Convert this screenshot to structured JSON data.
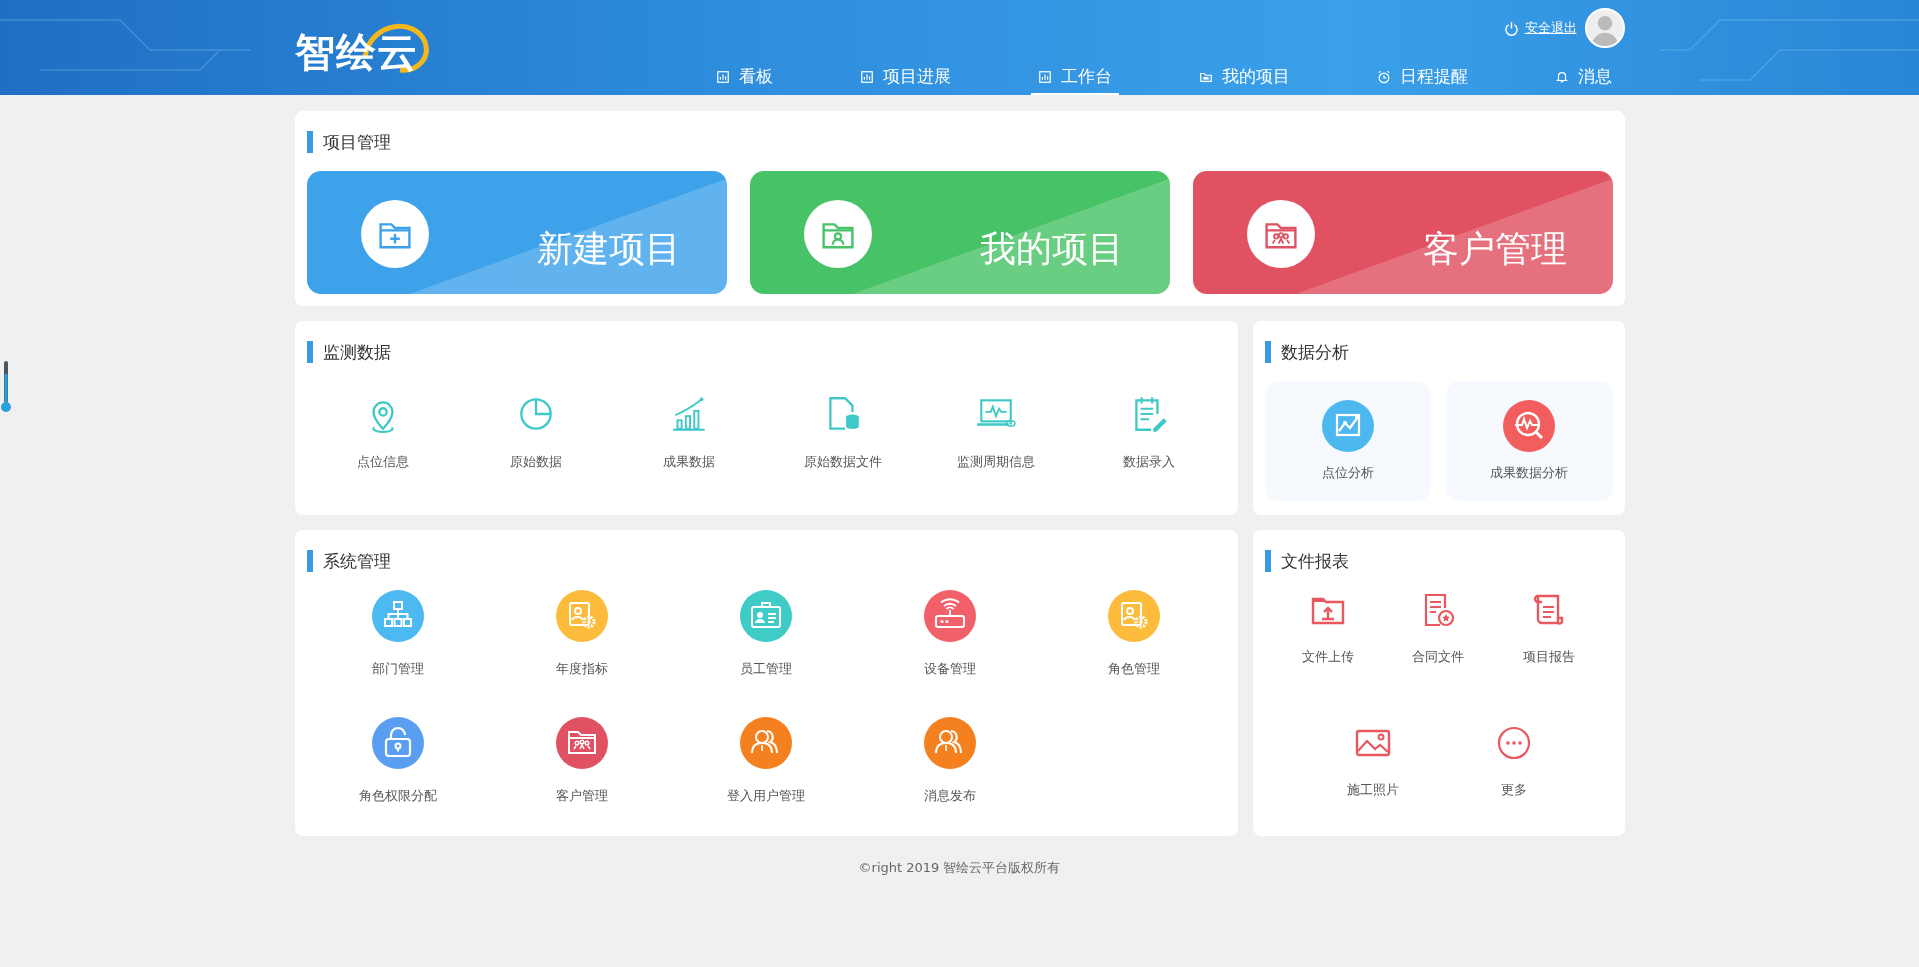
{
  "header": {
    "logo": "智绘云",
    "logout": "安全退出",
    "nav": [
      {
        "label": "看板",
        "selected": false
      },
      {
        "label": "项目进展",
        "selected": false
      },
      {
        "label": "工作台",
        "selected": true
      },
      {
        "label": "我的项目",
        "selected": false
      },
      {
        "label": "日程提醒",
        "selected": false
      },
      {
        "label": "消息",
        "selected": false
      }
    ]
  },
  "project_management": {
    "title": "项目管理",
    "tiles": [
      {
        "label": "新建项目",
        "color": "#3da2ea"
      },
      {
        "label": "我的项目",
        "color": "#48c267"
      },
      {
        "label": "客户管理",
        "color": "#e05262"
      }
    ]
  },
  "monitoring": {
    "title": "监测数据",
    "items": [
      "点位信息",
      "原始数据",
      "成果数据",
      "原始数据文件",
      "监测周期信息",
      "数据录入"
    ]
  },
  "analysis": {
    "title": "数据分析",
    "items": [
      {
        "label": "点位分析",
        "color": "#4db8f0"
      },
      {
        "label": "成果数据分析",
        "color": "#f25d5d"
      }
    ]
  },
  "system": {
    "title": "系统管理",
    "items": [
      {
        "label": "部门管理",
        "color": "#4cb9f0"
      },
      {
        "label": "年度指标",
        "color": "#fdbb3c"
      },
      {
        "label": "员工管理",
        "color": "#3fcbc8"
      },
      {
        "label": "设备管理",
        "color": "#f2606a"
      },
      {
        "label": "角色管理",
        "color": "#fdbb3c"
      },
      {
        "label": "角色权限分配",
        "color": "#5a9ef2"
      },
      {
        "label": "客户管理",
        "color": "#e05262"
      },
      {
        "label": "登入用户管理",
        "color": "#f5801f"
      },
      {
        "label": "消息发布",
        "color": "#f5801f"
      }
    ]
  },
  "files": {
    "title": "文件报表",
    "items": [
      "文件上传",
      "合同文件",
      "项目报告",
      "施工照片",
      "更多"
    ]
  },
  "footer": "©right 2019 智绘云平台版权所有"
}
